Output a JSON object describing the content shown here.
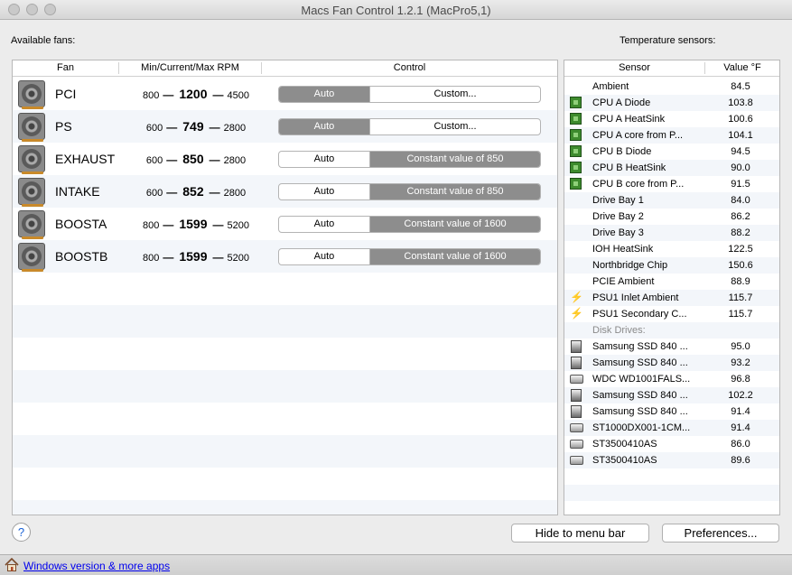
{
  "window": {
    "title": "Macs Fan Control 1.2.1 (MacPro5,1)"
  },
  "labels": {
    "available_fans": "Available fans:",
    "temperature_sensors": "Temperature sensors:"
  },
  "fans_table": {
    "headers": {
      "fan": "Fan",
      "rpm": "Min/Current/Max RPM",
      "control": "Control"
    },
    "rows": [
      {
        "name": "PCI",
        "min": "800",
        "current": "1200",
        "max": "4500",
        "auto": "Auto",
        "control": "Custom...",
        "mode": "auto"
      },
      {
        "name": "PS",
        "min": "600",
        "current": "749",
        "max": "2800",
        "auto": "Auto",
        "control": "Custom...",
        "mode": "auto"
      },
      {
        "name": "EXHAUST",
        "min": "600",
        "current": "850",
        "max": "2800",
        "auto": "Auto",
        "control": "Constant value of 850",
        "mode": "custom"
      },
      {
        "name": "INTAKE",
        "min": "600",
        "current": "852",
        "max": "2800",
        "auto": "Auto",
        "control": "Constant value of 850",
        "mode": "custom"
      },
      {
        "name": "BOOSTA",
        "min": "800",
        "current": "1599",
        "max": "5200",
        "auto": "Auto",
        "control": "Constant value of 1600",
        "mode": "custom"
      },
      {
        "name": "BOOSTB",
        "min": "800",
        "current": "1599",
        "max": "5200",
        "auto": "Auto",
        "control": "Constant value of 1600",
        "mode": "custom"
      }
    ]
  },
  "sensors_table": {
    "headers": {
      "sensor": "Sensor",
      "value": "Value °F"
    },
    "rows": [
      {
        "icon": "none",
        "name": "Ambient",
        "value": "84.5"
      },
      {
        "icon": "chip",
        "name": "CPU A Diode",
        "value": "103.8"
      },
      {
        "icon": "chip",
        "name": "CPU A HeatSink",
        "value": "100.6"
      },
      {
        "icon": "chip",
        "name": "CPU A core from P...",
        "value": "104.1"
      },
      {
        "icon": "chip",
        "name": "CPU B Diode",
        "value": "94.5"
      },
      {
        "icon": "chip",
        "name": "CPU B HeatSink",
        "value": "90.0"
      },
      {
        "icon": "chip",
        "name": "CPU B core from P...",
        "value": "91.5"
      },
      {
        "icon": "none",
        "name": "Drive Bay 1",
        "value": "84.0"
      },
      {
        "icon": "none",
        "name": "Drive Bay 2",
        "value": "86.2"
      },
      {
        "icon": "none",
        "name": "Drive Bay 3",
        "value": "88.2"
      },
      {
        "icon": "none",
        "name": "IOH HeatSink",
        "value": "122.5"
      },
      {
        "icon": "none",
        "name": "Northbridge Chip",
        "value": "150.6"
      },
      {
        "icon": "none",
        "name": "PCIE Ambient",
        "value": "88.9"
      },
      {
        "icon": "bolt",
        "name": "PSU1 Inlet Ambient",
        "value": "115.7"
      },
      {
        "icon": "bolt",
        "name": "PSU1 Secondary C...",
        "value": "115.7"
      },
      {
        "group": "Disk Drives:"
      },
      {
        "icon": "ssd",
        "name": "Samsung SSD 840 ...",
        "value": "95.0"
      },
      {
        "icon": "ssd",
        "name": "Samsung SSD 840 ...",
        "value": "93.2"
      },
      {
        "icon": "hdd",
        "name": "WDC WD1001FALS...",
        "value": "96.8"
      },
      {
        "icon": "ssd",
        "name": "Samsung SSD 840 ...",
        "value": "102.2"
      },
      {
        "icon": "ssd",
        "name": "Samsung SSD 840 ...",
        "value": "91.4"
      },
      {
        "icon": "hdd",
        "name": "ST1000DX001-1CM...",
        "value": "91.4"
      },
      {
        "icon": "hdd",
        "name": "ST3500410AS",
        "value": "86.0"
      },
      {
        "icon": "hdd",
        "name": "ST3500410AS",
        "value": "89.6"
      }
    ]
  },
  "buttons": {
    "help": "?",
    "hide_to_menu_bar": "Hide to menu bar",
    "preferences": "Preferences..."
  },
  "footer": {
    "link": "Windows version & more apps"
  },
  "colors": {
    "selected_segment": "#8d8d8d",
    "link": "#0000ee",
    "row_alt": "#f3f6fa"
  }
}
